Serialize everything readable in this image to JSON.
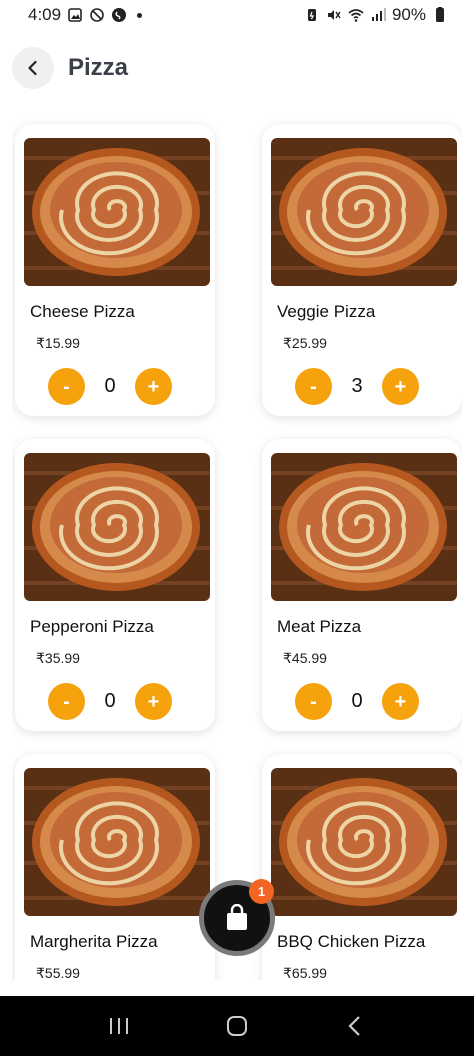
{
  "status_bar": {
    "time": "4:09",
    "battery": "90%"
  },
  "header": {
    "title": "Pizza"
  },
  "products": [
    {
      "name": "Cheese Pizza",
      "price": "₹15.99",
      "quantity": "0"
    },
    {
      "name": "Veggie Pizza",
      "price": "₹25.99",
      "quantity": "3"
    },
    {
      "name": "Pepperoni Pizza",
      "price": "₹35.99",
      "quantity": "0"
    },
    {
      "name": "Meat Pizza",
      "price": "₹45.99",
      "quantity": "0"
    },
    {
      "name": "Margherita Pizza",
      "price": "₹55.99",
      "quantity": ""
    },
    {
      "name": "BBQ Chicken Pizza",
      "price": "₹65.99",
      "quantity": ""
    }
  ],
  "controls": {
    "minus_label": "-",
    "plus_label": "+"
  },
  "cart": {
    "badge_count": "1"
  },
  "colors": {
    "accent": "#f5a20d",
    "badge": "#f26522",
    "card_bg": "#ffffff"
  }
}
